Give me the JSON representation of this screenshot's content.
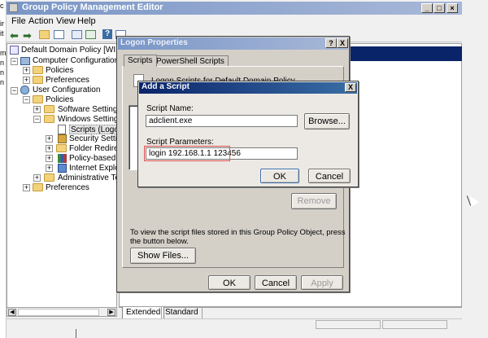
{
  "main_window": {
    "title": "Group Policy Management Editor",
    "menu": [
      "File",
      "Action",
      "View",
      "Help"
    ],
    "tree": [
      {
        "label": "Default Domain Policy [WIN-QOCB"
      },
      {
        "label": "Computer Configuration"
      },
      {
        "label": "Policies"
      },
      {
        "label": "Preferences"
      },
      {
        "label": "User Configuration"
      },
      {
        "label": "Policies"
      },
      {
        "label": "Software Settings"
      },
      {
        "label": "Windows Settings"
      },
      {
        "label": "Scripts (Logon/Logo"
      },
      {
        "label": "Security Settings"
      },
      {
        "label": "Folder Redirection"
      },
      {
        "label": "Policy-based QoS"
      },
      {
        "label": "Internet Explorer M"
      },
      {
        "label": "Administrative Templat"
      },
      {
        "label": "Preferences"
      }
    ],
    "bottom_tabs": [
      "Extended",
      "Standard"
    ],
    "left_edge_chars": [
      "c",
      "ir",
      "it",
      "m",
      "n",
      "n",
      "n"
    ]
  },
  "logon_dialog": {
    "title": "Logon Properties",
    "help_btn": "?",
    "close_btn": "X",
    "tabs": [
      "Scripts",
      "PowerShell Scripts"
    ],
    "heading": "Logon Scripts for Default Domain Policy",
    "remove_label": "Remove",
    "info_text_line1": "To view the script files stored in this Group Policy Object, press",
    "info_text_line2": "the button below.",
    "show_files_label": "Show Files...",
    "ok_label": "OK",
    "cancel_label": "Cancel",
    "apply_label": "Apply"
  },
  "add_script_dialog": {
    "title": "Add a Script",
    "close_btn": "X",
    "script_name_label": "Script Name:",
    "script_name_value": "adclient.exe",
    "browse_label": "Browse...",
    "script_params_label": "Script Parameters:",
    "script_params_value": "login 192.168.1.1 123456",
    "ok_label": "OK",
    "cancel_label": "Cancel",
    "highlight_color": "#e05050"
  }
}
